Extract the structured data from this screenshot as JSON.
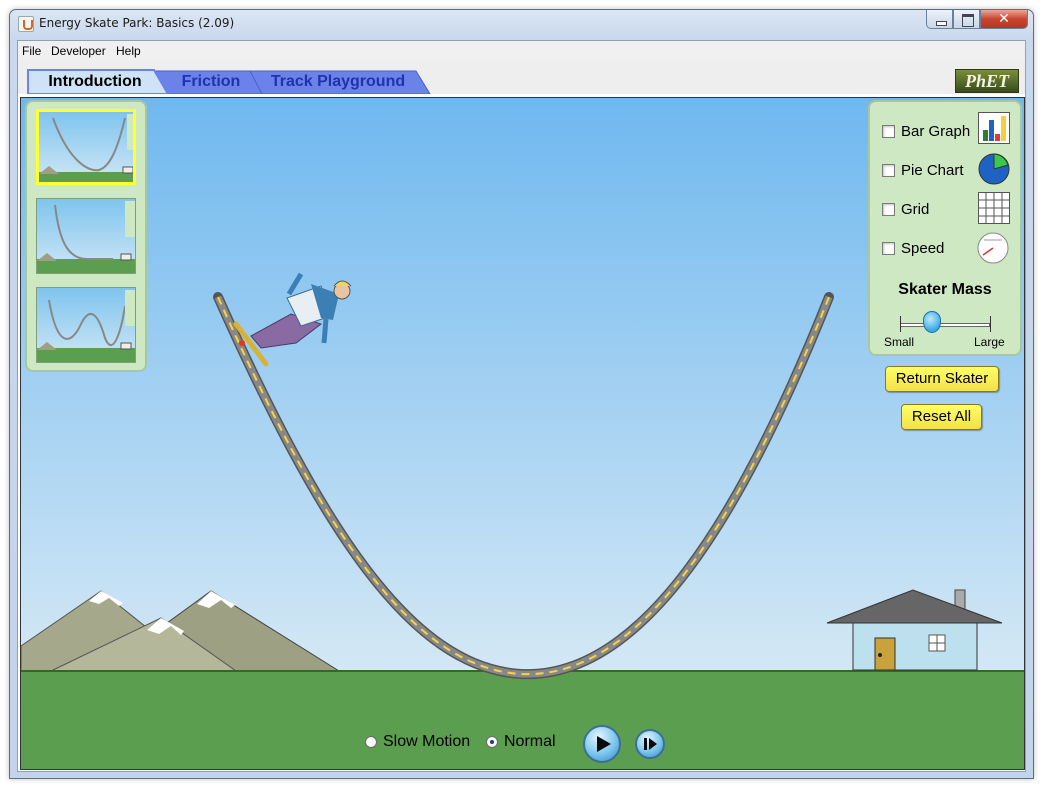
{
  "window": {
    "title": "Energy Skate Park: Basics (2.09)",
    "close_glyph": "✕"
  },
  "menu": {
    "items": [
      {
        "label": "File"
      },
      {
        "label": "Developer"
      },
      {
        "label": "Help"
      }
    ]
  },
  "tabs": [
    {
      "label": "Introduction",
      "active": true
    },
    {
      "label": "Friction",
      "active": false
    },
    {
      "label": "Track Playground",
      "active": false
    }
  ],
  "logo": {
    "text": "PhET"
  },
  "presets": {
    "selected_index": 0,
    "count": 3
  },
  "controls": {
    "bar_graph": {
      "label": "Bar Graph",
      "checked": false,
      "icon": "bar-graph-icon"
    },
    "pie_chart": {
      "label": "Pie Chart",
      "checked": false,
      "icon": "pie-chart-icon"
    },
    "grid": {
      "label": "Grid",
      "checked": false,
      "icon": "grid-icon"
    },
    "speed": {
      "label": "Speed",
      "checked": false,
      "icon": "speedometer-icon"
    },
    "mass_title": "Skater Mass",
    "mass_min_label": "Small",
    "mass_max_label": "Large"
  },
  "buttons": {
    "return_skater": "Return Skater",
    "reset_all": "Reset All"
  },
  "playback": {
    "slow_motion_label": "Slow Motion",
    "normal_label": "Normal",
    "selected": "Normal"
  },
  "colors": {
    "sky_top": "#6fb8ef",
    "sky_bottom": "#cfe5f4",
    "ground": "#5c9e4f",
    "panel": "#cfe8c4",
    "button_yellow": "#ffff66",
    "tab_blue": "#6b82ea"
  }
}
